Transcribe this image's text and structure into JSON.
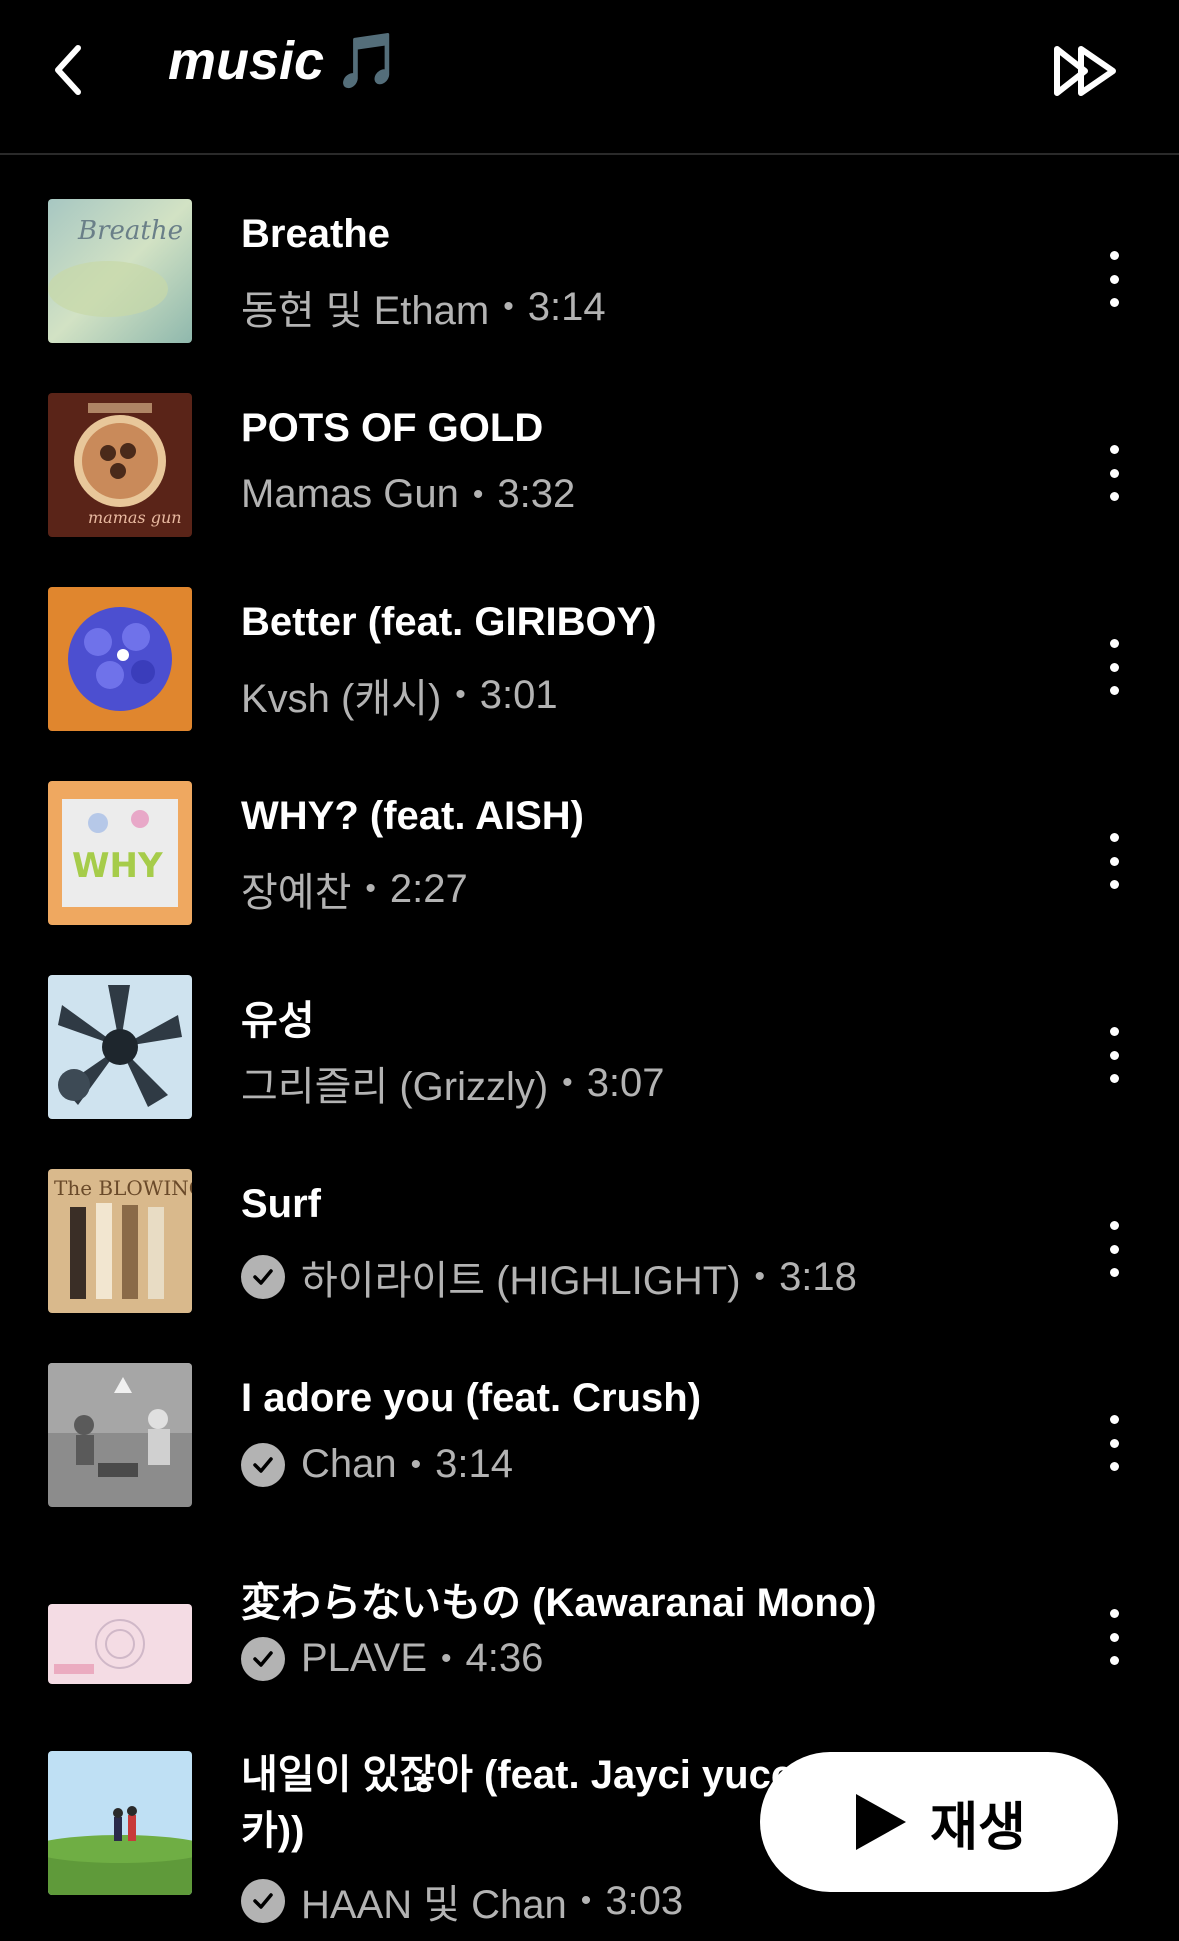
{
  "header": {
    "title": "music",
    "title_emoji": "🎵"
  },
  "songs": [
    {
      "title": "Breathe",
      "artist": "동현 및 Etham",
      "duration": "3:14",
      "verified": false
    },
    {
      "title": "POTS OF GOLD",
      "artist": "Mamas Gun",
      "duration": "3:32",
      "verified": false
    },
    {
      "title": "Better (feat. GIRIBOY)",
      "artist": "Kvsh (캐시)",
      "duration": "3:01",
      "verified": false
    },
    {
      "title": "WHY? (feat. AISH)",
      "artist": "장예찬",
      "duration": "2:27",
      "verified": false
    },
    {
      "title": "유성",
      "artist": "그리즐리 (Grizzly)",
      "duration": "3:07",
      "verified": false
    },
    {
      "title": "Surf",
      "artist": "하이라이트 (HIGHLIGHT)",
      "duration": "3:18",
      "verified": true
    },
    {
      "title": "I adore you (feat. Crush)",
      "artist": "Chan",
      "duration": "3:14",
      "verified": true
    },
    {
      "title": "変わらないもの (Kawaranai Mono)",
      "artist": "PLAVE",
      "duration": "4:36",
      "verified": true
    },
    {
      "title": "내일이 있잖아 (feat. Jayci yucca (제이씨 유카))",
      "artist": "HAAN 및 Chan",
      "duration": "3:03",
      "verified": true
    }
  ],
  "play_button": {
    "label": "재생"
  }
}
